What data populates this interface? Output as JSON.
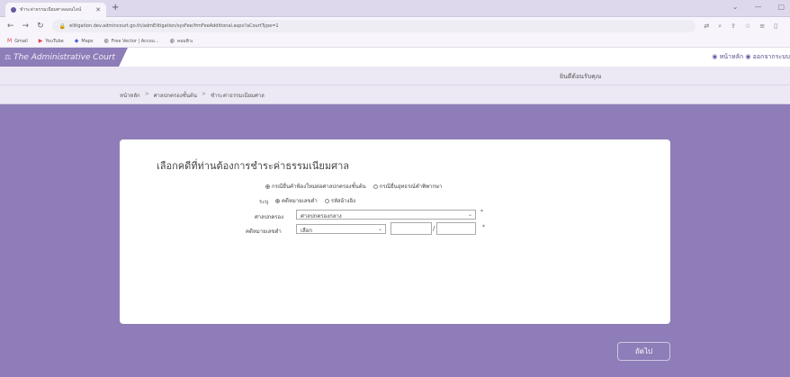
{
  "browser": {
    "tab_title": "ชำระค่าธรรมเนียมศาลออนไลน์",
    "new_tab": "+",
    "url": "elitigation.dev.admincourt.go.th/admEiltigation/sysFee/frmFeeAdditional.aspx?aCourtType=1",
    "window_controls": [
      "⌄",
      "—",
      "▢"
    ],
    "bookmarks": [
      {
        "label": "Gmail",
        "icon": "gmail-icon"
      },
      {
        "label": "YouTube",
        "icon": "youtube-icon"
      },
      {
        "label": "Maps",
        "icon": "maps-icon"
      },
      {
        "label": "Free Vector | Accou...",
        "icon": "globe-icon"
      },
      {
        "label": "คอมพิวเ",
        "icon": "globe-icon"
      }
    ]
  },
  "site": {
    "name": "The Administrative Court",
    "top_link_home": "หน้าหลัก",
    "top_link_logout": "ออกจากระบบ",
    "welcome": "ยินดีต้อนรับคุณ"
  },
  "breadcrumb": [
    "หน้าหลัก",
    "ศาลปกครองชั้นต้น",
    "ชำระค่าธรรมเนียมศาล"
  ],
  "form": {
    "heading": "เลือกคดีที่ท่านต้องการชำระค่าธรรมเนียมศาล",
    "type_options": [
      "กรณียื่นคำฟ้องใหม่ต่อศาลปกครองชั้นต้น",
      "กรณียื่นอุทธรณ์คำพิพากษา"
    ],
    "specify_label": "ระบุ",
    "specify_options": [
      "คดีหมายเลขดำ",
      "รหัสอ้างอิง"
    ],
    "court_label": "ศาลปกครอง",
    "court_value": "ศาลปกครองกลาง",
    "case_label": "คดีหมายเลขดำ",
    "case_select_value": "เลือก",
    "required_mark": "*",
    "slash": "/"
  },
  "next_button": "ถัดไป"
}
